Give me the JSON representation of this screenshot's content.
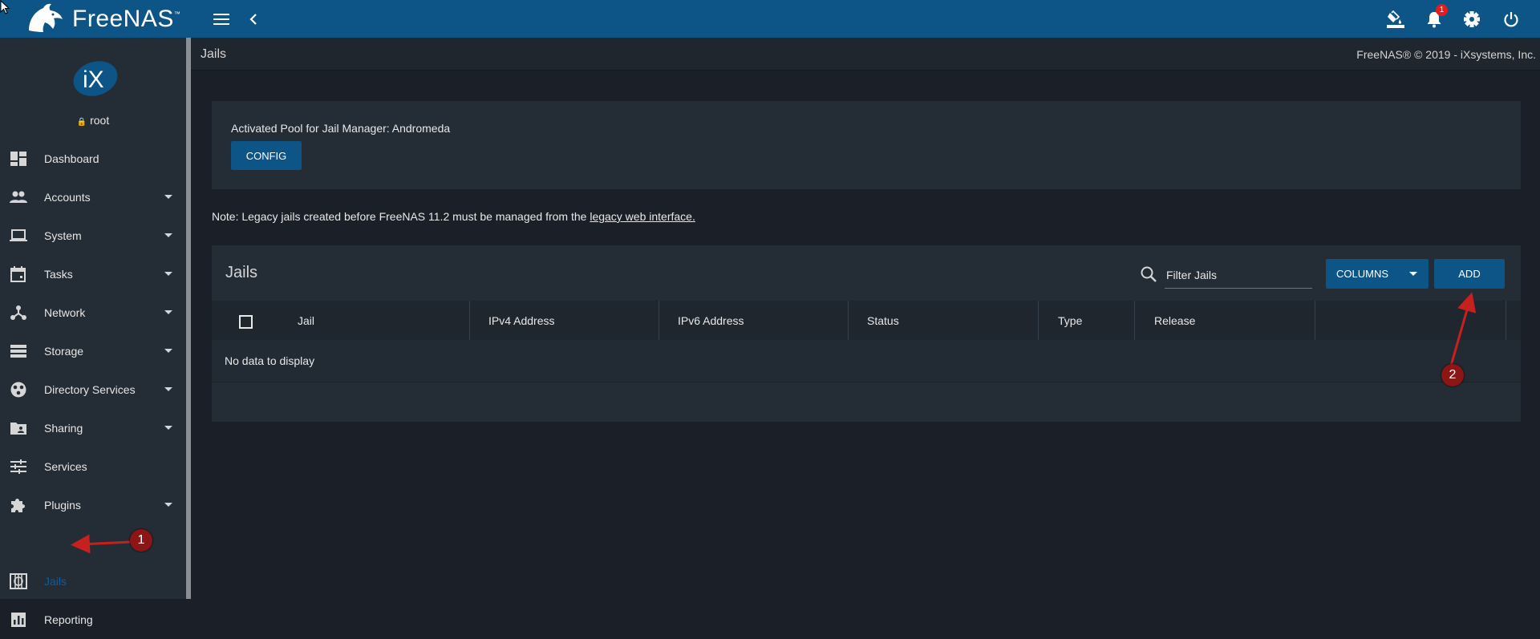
{
  "app": {
    "brand": "FreeNAS",
    "brand_tm": "™",
    "notification_count": "1"
  },
  "user": {
    "name": "root"
  },
  "sidebar": {
    "items": [
      {
        "label": "Dashboard",
        "icon": "dashboard-icon"
      },
      {
        "label": "Accounts",
        "icon": "people-icon"
      },
      {
        "label": "System",
        "icon": "laptop-icon"
      },
      {
        "label": "Tasks",
        "icon": "calendar-icon"
      },
      {
        "label": "Network",
        "icon": "network-icon"
      },
      {
        "label": "Storage",
        "icon": "storage-icon"
      },
      {
        "label": "Directory Services",
        "icon": "directory-icon"
      },
      {
        "label": "Sharing",
        "icon": "folder-shared-icon"
      },
      {
        "label": "Services",
        "icon": "tune-icon"
      },
      {
        "label": "Plugins",
        "icon": "puzzle-icon"
      },
      {
        "label": "Jails",
        "icon": "jail-icon",
        "active": true
      },
      {
        "label": "Reporting",
        "icon": "chart-icon"
      }
    ]
  },
  "header": {
    "page_title": "Jails",
    "copyright": "FreeNAS® © 2019 - iXsystems, Inc."
  },
  "pool": {
    "text": "Activated Pool for Jail Manager: Andromeda",
    "config_label": "CONFIG"
  },
  "note": {
    "prefix": "Note: Legacy jails created before FreeNAS 11.2 must be managed from the",
    "link": "legacy web interface."
  },
  "table": {
    "title": "Jails",
    "filter_placeholder": "Filter Jails",
    "columns_label": "COLUMNS",
    "add_label": "ADD",
    "headers": [
      "Jail",
      "IPv4 Address",
      "IPv6 Address",
      "Status",
      "Type",
      "Release"
    ],
    "empty_text": "No data to display"
  },
  "annotations": {
    "marker1": "1",
    "marker2": "2"
  },
  "colors": {
    "accent": "#0d5487",
    "sidebar": "#242c35",
    "background": "#1b2028",
    "active": "#0d5e9c",
    "marker": "#8c1515"
  }
}
